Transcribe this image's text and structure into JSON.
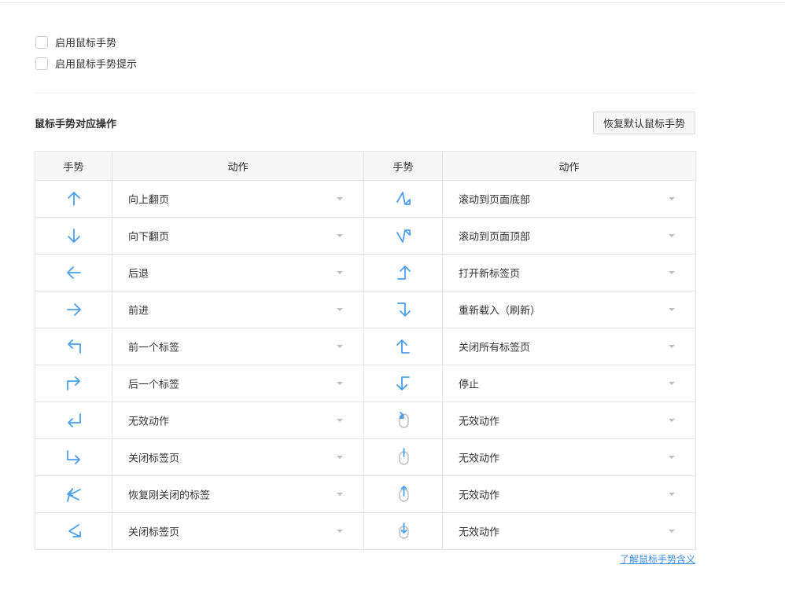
{
  "options": [
    {
      "label": "启用鼠标手势",
      "checked": false
    },
    {
      "label": "启用鼠标手势提示",
      "checked": false
    }
  ],
  "section_title": "鼠标手势对应操作",
  "restore_button": "恢复默认鼠标手势",
  "table": {
    "headers": [
      "手势",
      "动作",
      "手势",
      "动作"
    ],
    "rows": [
      {
        "left_icon": "arrow-up-icon",
        "left_action": "向上翻页",
        "right_icon": "zigzag-down-icon",
        "right_action": "滚动到页面底部"
      },
      {
        "left_icon": "arrow-down-icon",
        "left_action": "向下翻页",
        "right_icon": "zigzag-up-icon",
        "right_action": "滚动到页面顶部"
      },
      {
        "left_icon": "arrow-left-icon",
        "left_action": "后退",
        "right_icon": "right-then-up-icon",
        "right_action": "打开新标签页"
      },
      {
        "left_icon": "arrow-right-icon",
        "left_action": "前进",
        "right_icon": "right-then-down-icon",
        "right_action": "重新载入（刷新）"
      },
      {
        "left_icon": "up-then-left-icon",
        "left_action": "前一个标签",
        "right_icon": "left-then-up-icon",
        "right_action": "关闭所有标签页"
      },
      {
        "left_icon": "up-then-right-icon",
        "left_action": "后一个标签",
        "right_icon": "left-then-down-icon",
        "right_action": "停止"
      },
      {
        "left_icon": "down-then-left-icon",
        "left_action": "无效动作",
        "right_icon": "mouse-left-click-icon",
        "right_action": "无效动作"
      },
      {
        "left_icon": "down-then-right-icon",
        "left_action": "关闭标签页",
        "right_icon": "mouse-scroll-icon",
        "right_action": "无效动作"
      },
      {
        "left_icon": "zigzag-left-icon",
        "left_action": "恢复刚关闭的标签",
        "right_icon": "mouse-wheel-up-icon",
        "right_action": "无效动作"
      },
      {
        "left_icon": "zigzag-left-down-icon",
        "left_action": "关闭标签页",
        "right_icon": "mouse-wheel-down-icon",
        "right_action": "无效动作"
      }
    ]
  },
  "help_link": "了解鼠标手势含义",
  "colors": {
    "accent": "#3b8ee6",
    "icon": "#4a9ff0"
  }
}
